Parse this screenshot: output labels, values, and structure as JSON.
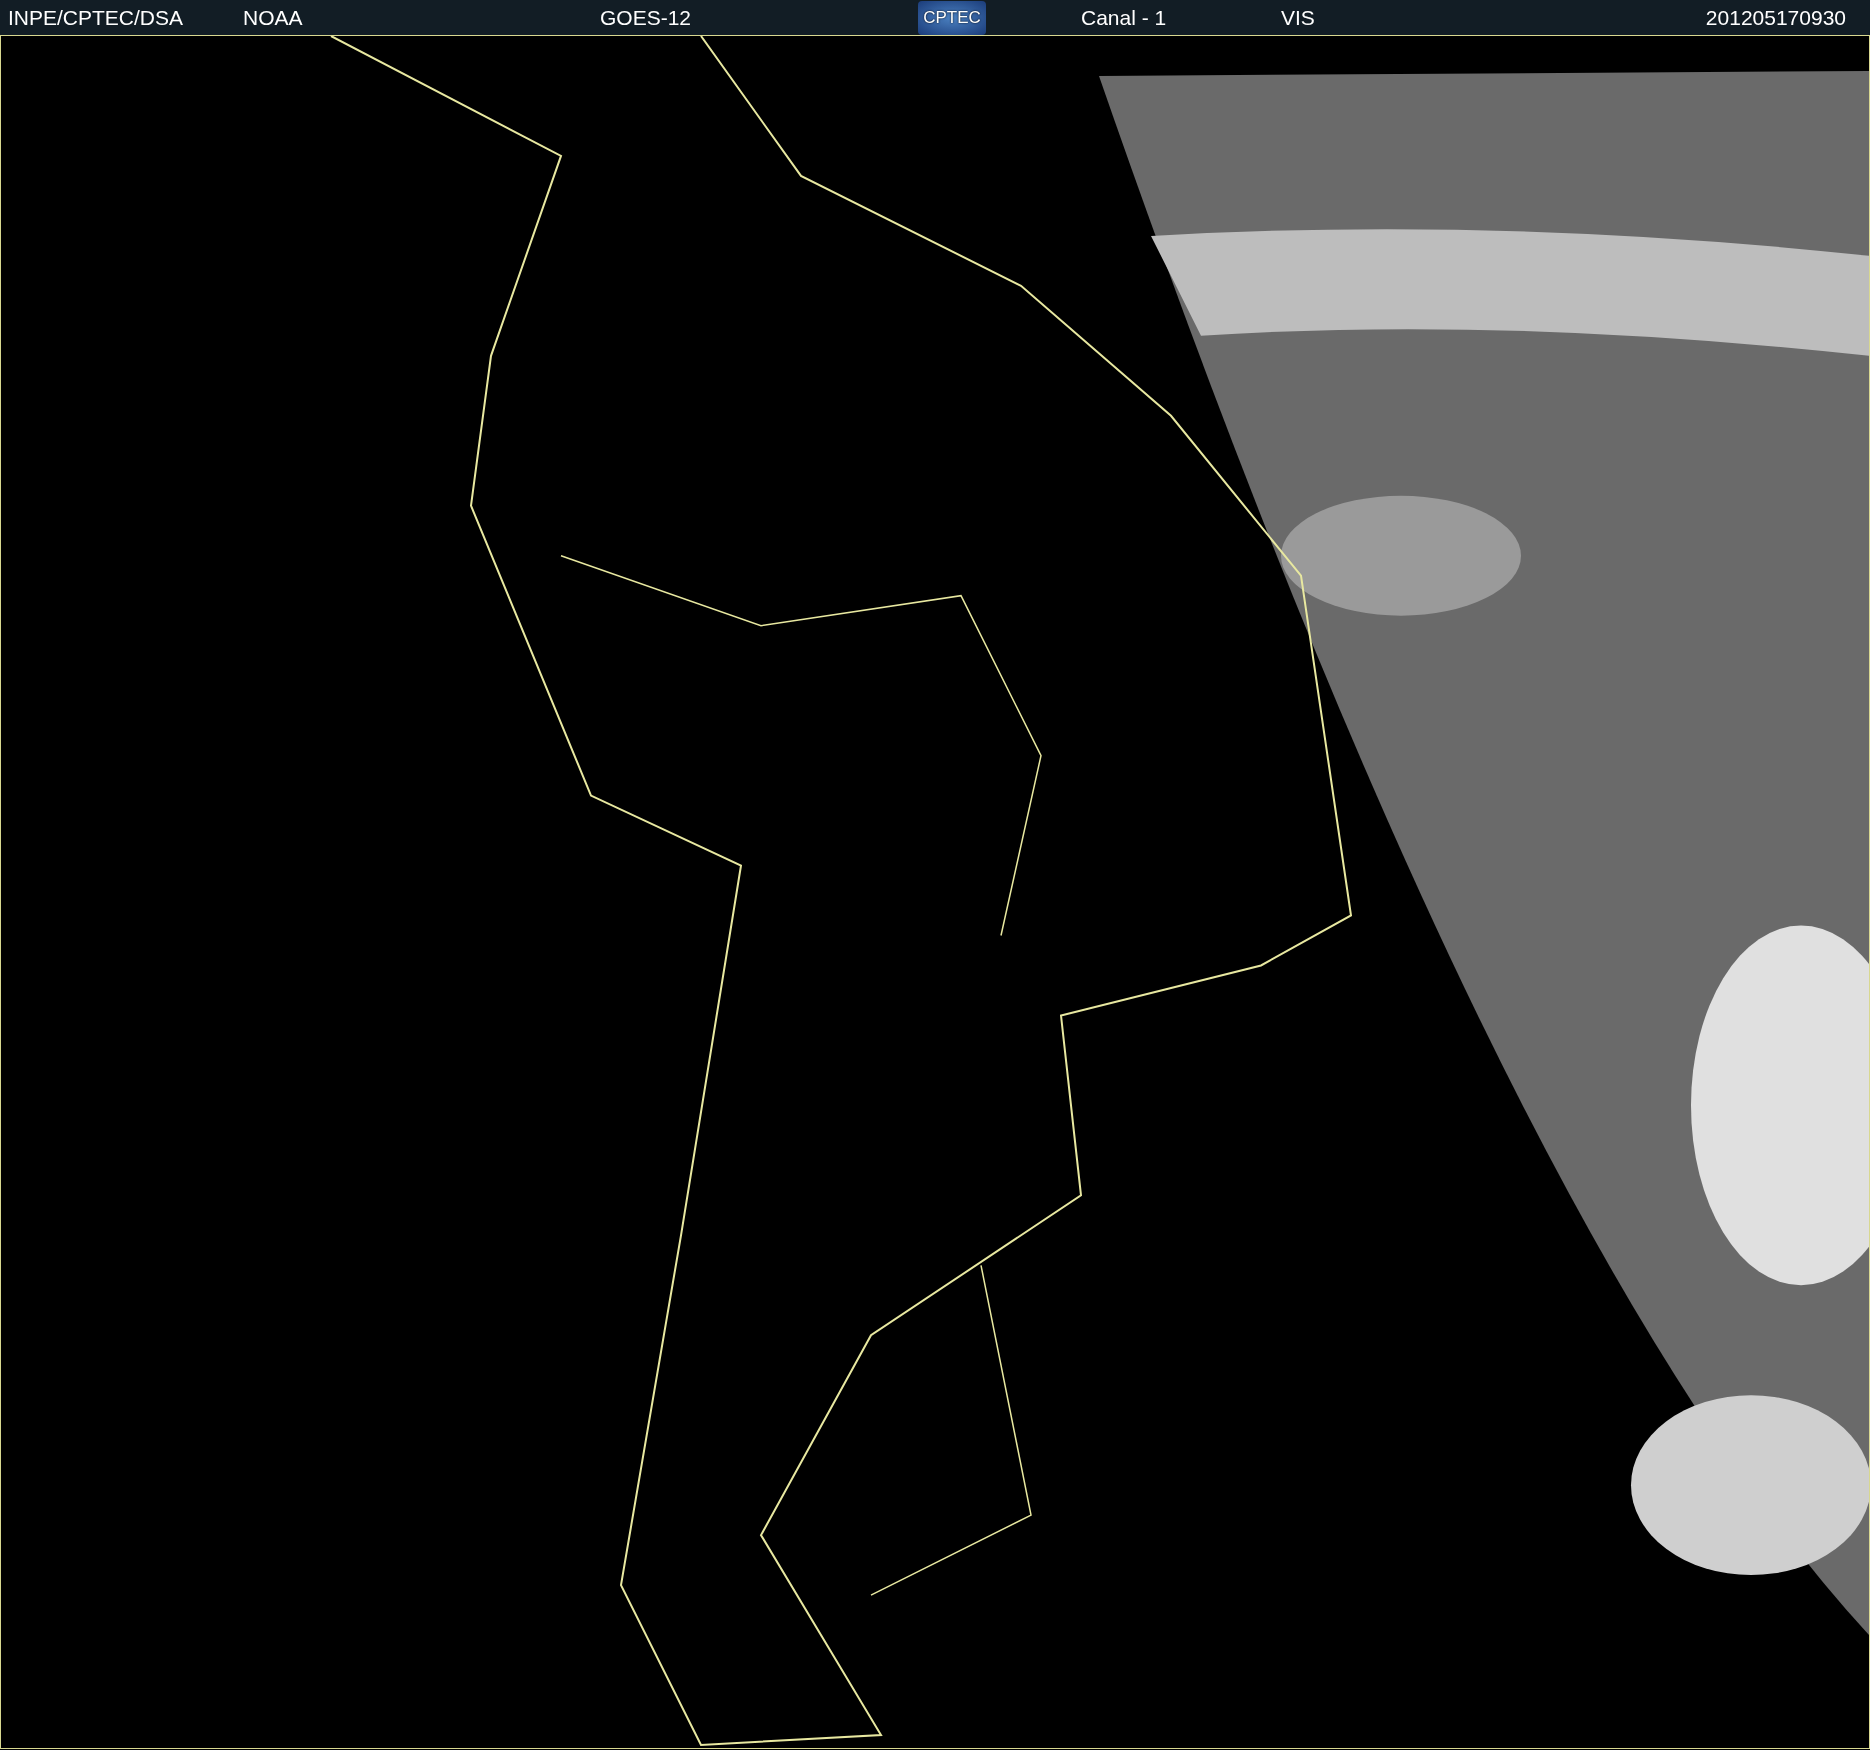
{
  "header": {
    "source": "INPE/CPTEC/DSA",
    "agency": "NOAA",
    "satellite": "GOES-12",
    "logo": "CPTEC",
    "channel": "Canal - 1",
    "band": "VIS",
    "timestamp": "201205170930"
  }
}
